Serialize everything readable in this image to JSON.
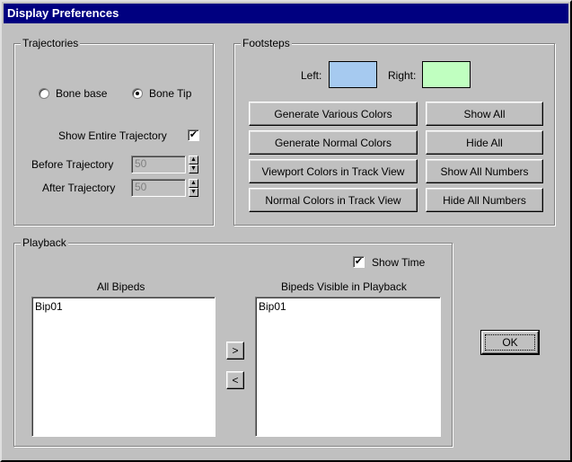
{
  "window": {
    "title": "Display Preferences"
  },
  "trajectories": {
    "title": "Trajectories",
    "bone_base": {
      "label": "Bone base",
      "selected": false
    },
    "bone_tip": {
      "label": "Bone Tip",
      "selected": true
    },
    "show_entire": {
      "label": "Show Entire Trajectory",
      "checked": true
    },
    "before": {
      "label": "Before Trajectory",
      "value": "50"
    },
    "after": {
      "label": "After Trajectory",
      "value": "50"
    }
  },
  "footsteps": {
    "title": "Footsteps",
    "left_label": "Left:",
    "right_label": "Right:",
    "left_color": "#a6caf0",
    "right_color": "#c0ffc0",
    "buttons": {
      "generate_various": "Generate Various Colors",
      "generate_normal": "Generate Normal Colors",
      "viewport_colors": "Viewport Colors in Track View",
      "normal_colors": "Normal Colors in Track View",
      "show_all": "Show All",
      "hide_all": "Hide All",
      "show_all_numbers": "Show All Numbers",
      "hide_all_numbers": "Hide All Numbers"
    }
  },
  "playback": {
    "title": "Playback",
    "show_time": {
      "label": "Show Time",
      "checked": true
    },
    "all_bipeds": {
      "title": "All Bipeds",
      "items": [
        "Bip01"
      ]
    },
    "visible_bipeds": {
      "title": "Bipeds Visible in Playback",
      "items": [
        "Bip01"
      ]
    },
    "move_right": ">",
    "move_left": "<"
  },
  "ok_button": "OK",
  "icons": {
    "checkmark": "✔",
    "spin_up": "▲",
    "spin_down": "▼"
  }
}
